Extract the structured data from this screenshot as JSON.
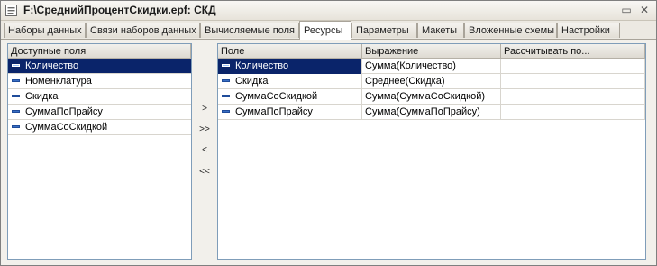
{
  "window": {
    "title": "F:\\СреднийПроцентСкидки.epf: СКД",
    "minimize_glyph": "▭",
    "close_glyph": "✕"
  },
  "tabs": [
    {
      "label": "Наборы данных",
      "active": false
    },
    {
      "label": "Связи наборов данных",
      "active": false
    },
    {
      "label": "Вычисляемые поля",
      "active": false
    },
    {
      "label": "Ресурсы",
      "active": true
    },
    {
      "label": "Параметры",
      "active": false
    },
    {
      "label": "Макеты",
      "active": false
    },
    {
      "label": "Вложенные схемы",
      "active": false
    },
    {
      "label": "Настройки",
      "active": false
    }
  ],
  "available_fields": {
    "header": "Доступные поля",
    "items": [
      {
        "label": "Количество",
        "selected": true
      },
      {
        "label": "Номенклатура",
        "selected": false
      },
      {
        "label": "Скидка",
        "selected": false
      },
      {
        "label": "СуммаПоПрайсу",
        "selected": false
      },
      {
        "label": "СуммаСоСкидкой",
        "selected": false
      }
    ]
  },
  "move_buttons": {
    "add": ">",
    "add_all": ">>",
    "remove": "<",
    "remove_all": "<<"
  },
  "resources": {
    "columns": [
      "Поле",
      "Выражение",
      "Рассчитывать по..."
    ],
    "rows": [
      {
        "field": "Количество",
        "expression": "Сумма(Количество)",
        "calc_by": "",
        "selected": true
      },
      {
        "field": "Скидка",
        "expression": "Среднее(Скидка)",
        "calc_by": "",
        "selected": false
      },
      {
        "field": "СуммаСоСкидкой",
        "expression": "Сумма(СуммаСоСкидкой)",
        "calc_by": "",
        "selected": false
      },
      {
        "field": "СуммаПоПрайсу",
        "expression": "Сумма(СуммаПоПрайсу)",
        "calc_by": "",
        "selected": false
      }
    ]
  },
  "colors": {
    "selection": "#0a246a",
    "tab_border": "#a9a49a"
  }
}
